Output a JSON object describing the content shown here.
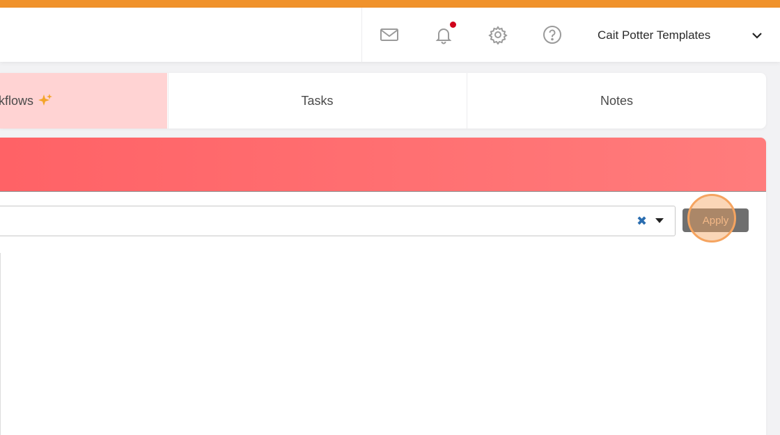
{
  "header": {
    "account_name": "Cait Potter Templates",
    "icons": [
      "mail-icon",
      "bell-icon",
      "gear-icon",
      "help-icon",
      "chevron-down-icon"
    ],
    "notification_dot_color": "#d0021b"
  },
  "tabs": [
    {
      "label": "kflows",
      "active": true
    },
    {
      "label": "Tasks",
      "active": false
    },
    {
      "label": "Notes",
      "active": false
    }
  ],
  "filter": {
    "apply_label": "Apply",
    "clear_symbol": "✖"
  },
  "colors": {
    "accent_bar": "#f0922b",
    "banner_start": "#ff6266",
    "banner_end": "#ff7c7c",
    "active_tab": "#ffd3d3",
    "apply_button": "#6f6f6f"
  }
}
